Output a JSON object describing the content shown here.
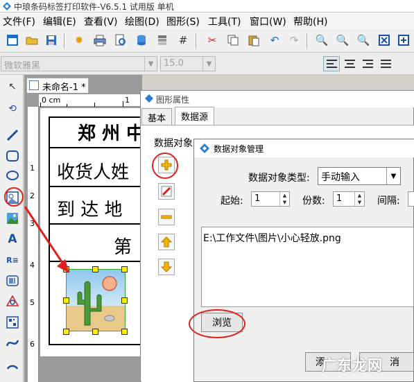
{
  "window": {
    "title": "中琅条码标签打印软件-V6.5.1 试用版 单机"
  },
  "menu": [
    "文件(F)",
    "编辑(E)",
    "查看(V)",
    "绘图(D)",
    "图形(S)",
    "工具(T)",
    "窗口(W)",
    "帮助(H)"
  ],
  "fontbar": {
    "font_name": "微软雅黑",
    "font_size": "15.0"
  },
  "document": {
    "tab_label": "未命名-1 *",
    "ruler_unit": "0 cm",
    "ruler_top_marks": [
      "1"
    ],
    "ruler_left_marks": [
      "1",
      "2",
      "3",
      "4",
      "5",
      "6"
    ],
    "label_texts": {
      "header": "郑 州 中",
      "receiver": "收货人姓",
      "arrival": "到 达 地",
      "page": "第"
    }
  },
  "graphic_properties_dialog": {
    "title": "图形属性",
    "tabs": [
      "基本",
      "数据源"
    ],
    "data_object_label": "数据对象"
  },
  "data_object_manager_dialog": {
    "title": "数据对象管理",
    "type_label": "数据对象类型:",
    "type_value": "手动输入",
    "start_label": "起始:",
    "start_value": "1",
    "copies_label": "份数:",
    "copies_value": "1",
    "interval_label": "间隔:",
    "data_value": "E:\\工作文件\\图片\\小心轻放.png",
    "browse_button": "浏览",
    "footer_button_partial": "添",
    "footer_button_right_partial": "消"
  },
  "watermark": "广东龙网",
  "colors": {
    "annotation_red": "#e02020",
    "selection_green": "#38a838",
    "handle_yellow": "#ffee00"
  }
}
